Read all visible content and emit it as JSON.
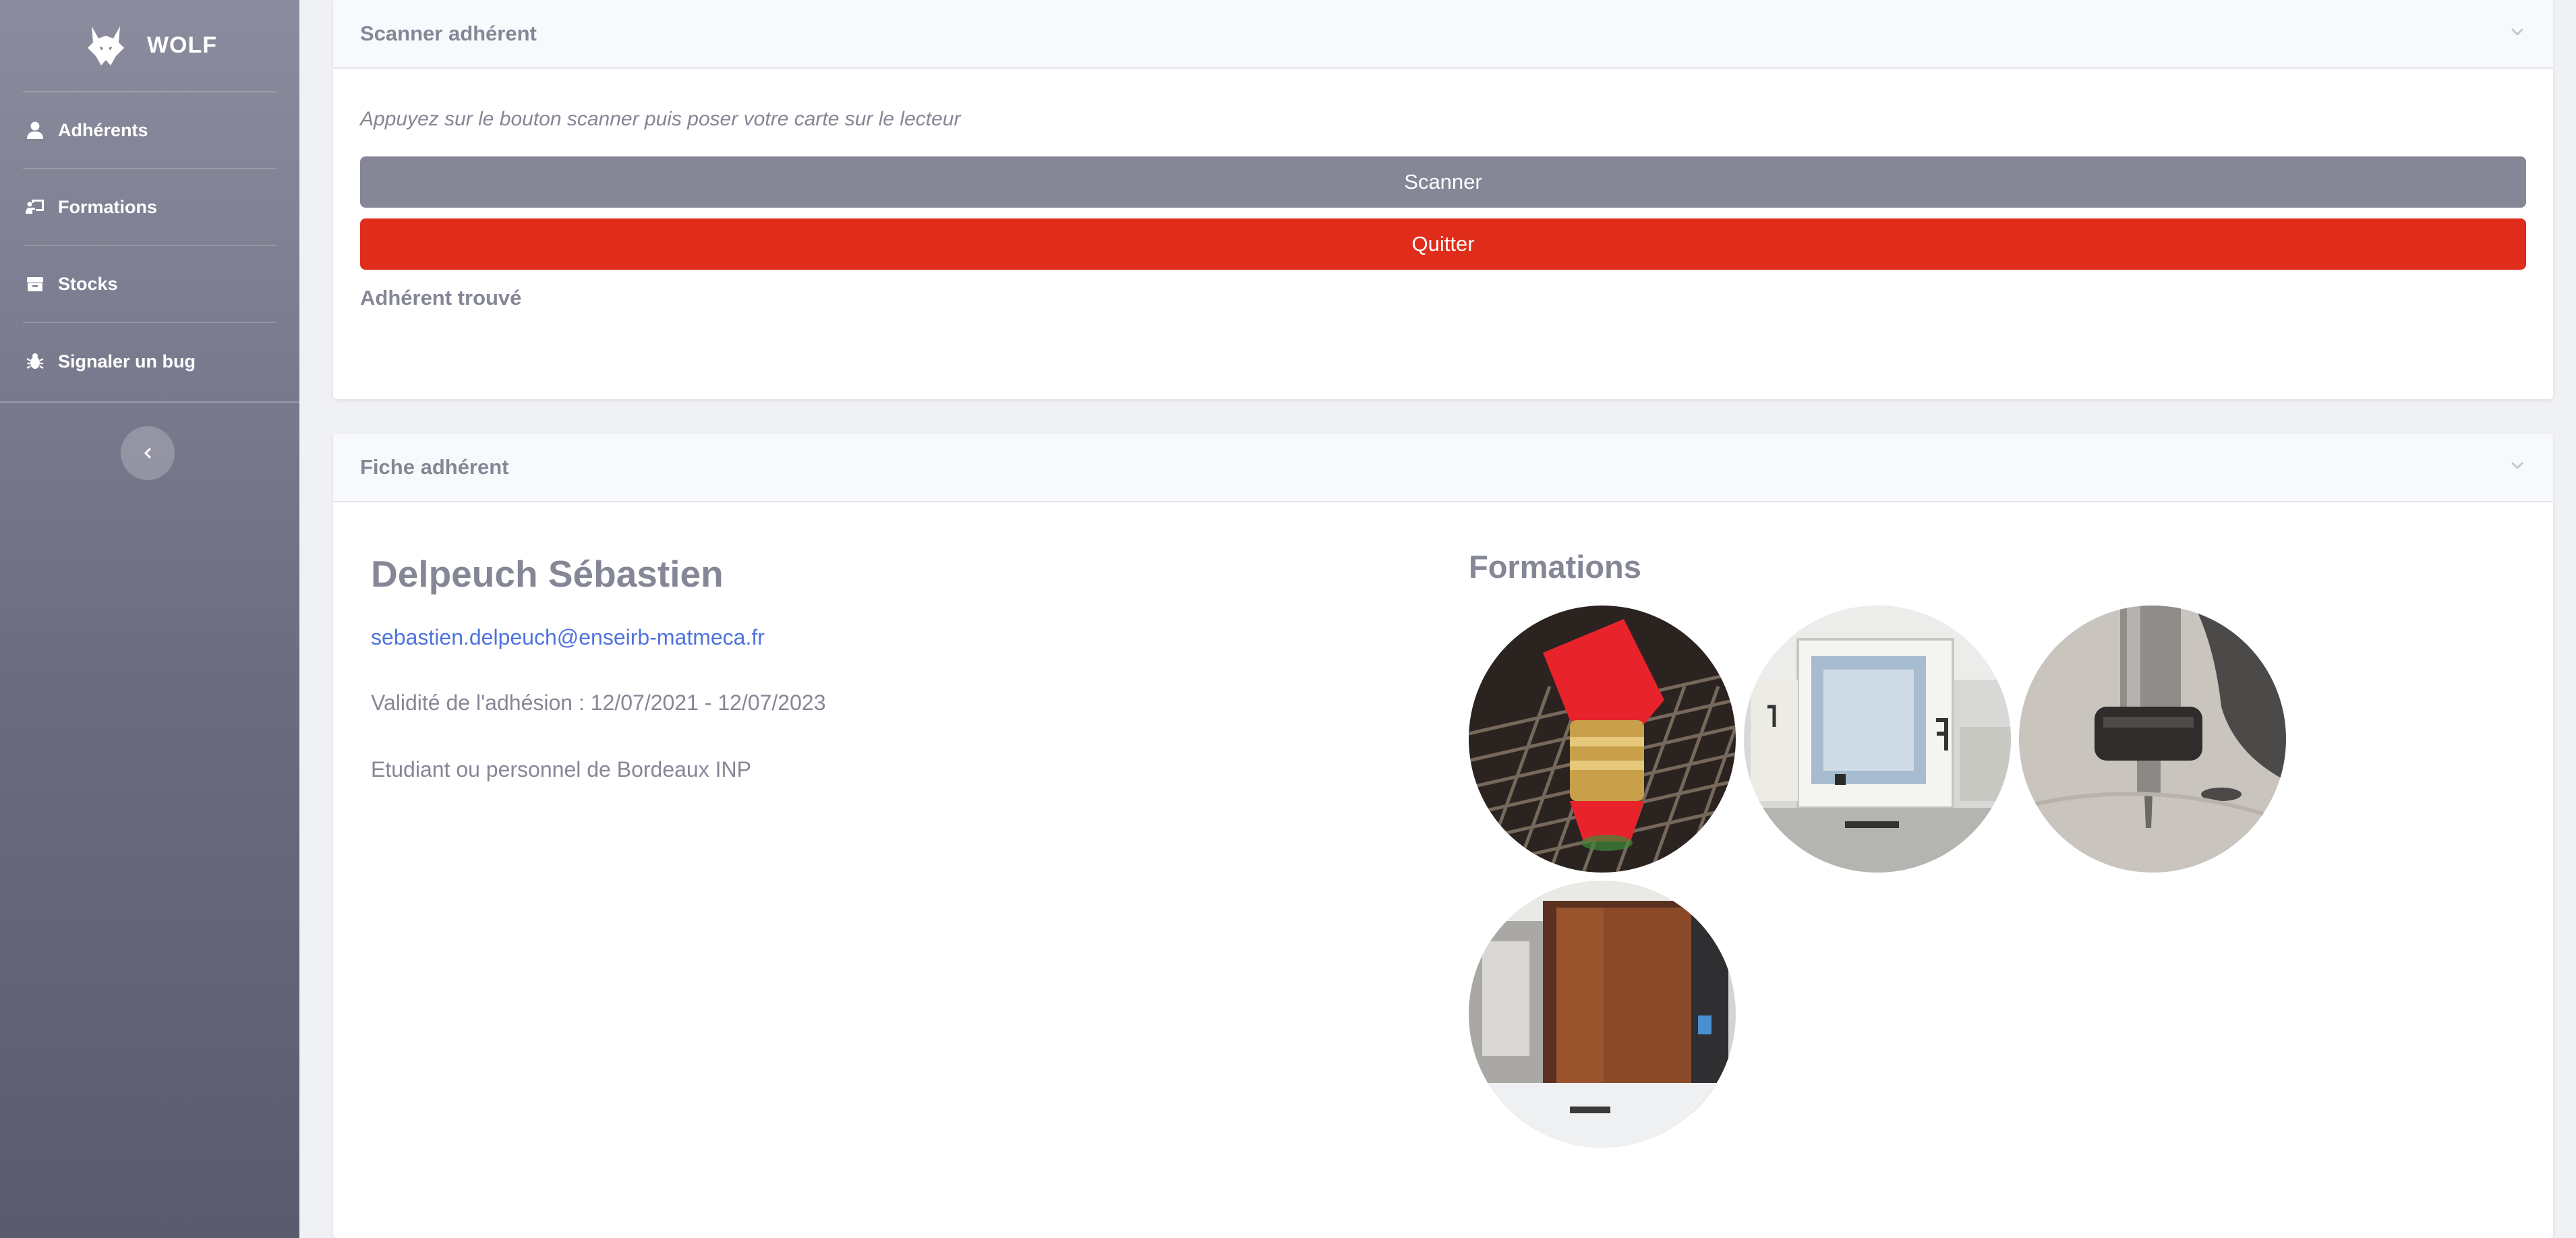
{
  "brand": {
    "name": "WOLF"
  },
  "sidebar": {
    "items": [
      {
        "label": "Adhérents",
        "icon": "user-icon"
      },
      {
        "label": "Formations",
        "icon": "chalkboard-teacher-icon"
      },
      {
        "label": "Stocks",
        "icon": "boxes-icon"
      },
      {
        "label": "Signaler un bug",
        "icon": "bug-icon"
      }
    ],
    "toggle_icon": "chevron-left-icon"
  },
  "scanner_card": {
    "title": "Scanner adhérent",
    "hint": "Appuyez sur le bouton scanner puis poser votre carte sur le lecteur",
    "scan_label": "Scanner",
    "quit_label": "Quitter",
    "status": "Adhérent trouvé"
  },
  "member_card": {
    "title": "Fiche adhérent",
    "name": "Delpeuch Sébastien",
    "email": "sebastien.delpeuch@enseirb-matmeca.fr",
    "validity": "Validité de l'adhésion : 12/07/2021 - 12/07/2023",
    "status_line": "Etudiant ou personnel de Bordeaux INP",
    "formations_title": "Formations",
    "formations": [
      {
        "name": "laser-cutter-photo"
      },
      {
        "name": "3d-printer-photo"
      },
      {
        "name": "cnc-mill-photo"
      },
      {
        "name": "resin-printer-photo"
      }
    ]
  },
  "colors": {
    "accent_grey": "#858796",
    "danger": "#e02d1b",
    "link": "#4e73df"
  }
}
